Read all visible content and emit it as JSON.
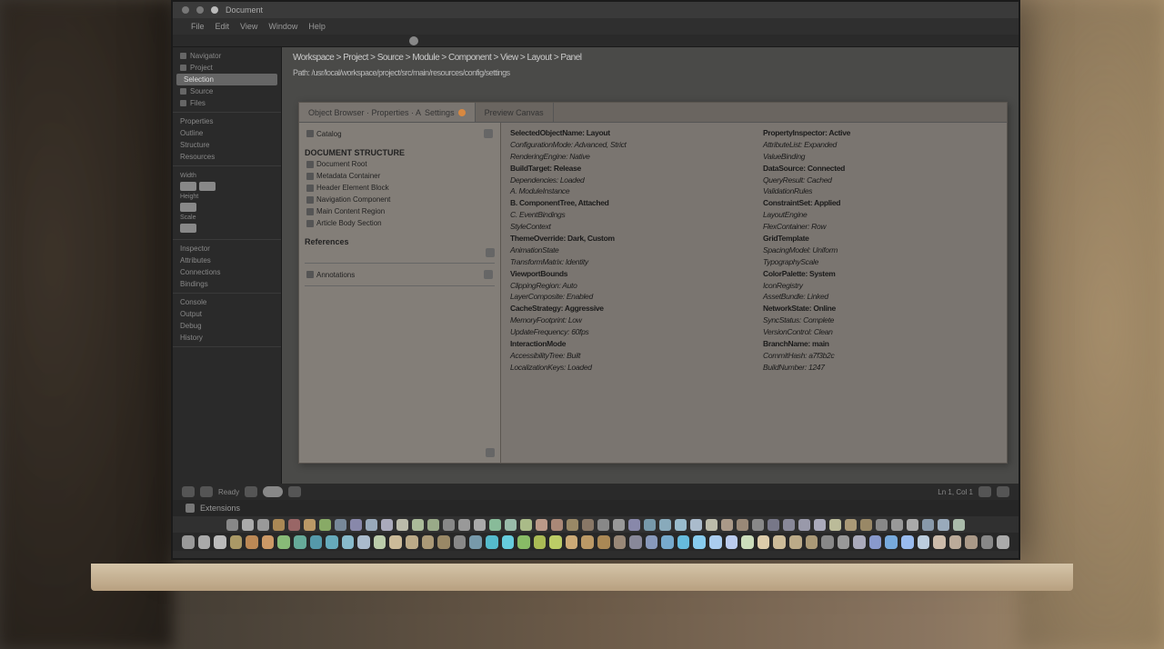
{
  "titlebar": {
    "label": "Document"
  },
  "menubar": {
    "items": [
      "File",
      "Edit",
      "View",
      "Window",
      "Help"
    ]
  },
  "sidebar": {
    "section1": [
      "Navigator",
      "Project",
      "Source",
      "Files"
    ],
    "highlighted": "Selection",
    "section2": [
      "Properties",
      "Outline",
      "Structure",
      "Resources"
    ],
    "controls": {
      "label1": "Width",
      "label2": "Height",
      "label3": "Scale"
    },
    "section3": [
      "Inspector",
      "Attributes",
      "Connections",
      "Bindings"
    ],
    "section4": [
      "Console",
      "Output",
      "Debug",
      "History"
    ]
  },
  "breadcrumb": {
    "line1": "Workspace > Project > Source > Module > Component > View > Layout > Panel",
    "line2": "Path: /usr/local/workspace/project/src/main/resources/config/settings"
  },
  "panel": {
    "tab1": "Object Browser · Properties · A",
    "tab1_suffix": "Settings",
    "tab2": "Preview Canvas",
    "left": {
      "header": "Catalog",
      "section1_title": "DOCUMENT STRUCTURE",
      "section1_items": [
        "Document Root",
        "Metadata Container",
        "Header Element Block",
        "Navigation Component",
        "Main Content Region",
        "Article Body Section"
      ],
      "section2_title": "References",
      "footer_item": "Annotations"
    },
    "col1": [
      "SelectedObjectName: Layout",
      "ConfigurationMode: Advanced, Strict",
      "RenderingEngine: Native",
      "BuildTarget: Release",
      "Dependencies: Loaded",
      "A. ModuleInstance",
      "B. ComponentTree, Attached",
      "C. EventBindings",
      "StyleContext",
      "ThemeOverride: Dark, Custom",
      "AnimationState",
      "TransformMatrix: Identity",
      "ViewportBounds",
      "ClippingRegion: Auto",
      "LayerComposite: Enabled",
      "CacheStrategy: Aggressive",
      "MemoryFootprint: Low",
      "UpdateFrequency: 60fps",
      "InteractionMode",
      "AccessibilityTree: Built",
      "LocalizationKeys: Loaded"
    ],
    "col2": [
      "PropertyInspector: Active",
      "AttributeList: Expanded",
      "ValueBinding",
      "DataSource: Connected",
      "QueryResult: Cached",
      "ValidationRules",
      "ConstraintSet: Applied",
      "LayoutEngine",
      "FlexContainer: Row",
      "GridTemplate",
      "SpacingModel: Uniform",
      "TypographyScale",
      "ColorPalette: System",
      "IconRegistry",
      "AssetBundle: Linked",
      "NetworkState: Online",
      "SyncStatus: Complete",
      "VersionControl: Clean",
      "BranchName: main",
      "CommitHash: a7f3b2c",
      "BuildNumber: 1247"
    ]
  },
  "statusbar": {
    "left": "Ready",
    "right": "Ln 1, Col 1"
  },
  "toolbar_text": "Extensions",
  "dock1_colors": [
    "#888",
    "#aaa",
    "#999",
    "#a85",
    "#966",
    "#b96",
    "#8a6",
    "#789",
    "#88a",
    "#9ab",
    "#aab",
    "#bba",
    "#ab9",
    "#9a8",
    "#888",
    "#999",
    "#aaa",
    "#8b9",
    "#9ba",
    "#ab8",
    "#b98",
    "#a87",
    "#986",
    "#876",
    "#888",
    "#999",
    "#88a",
    "#79a",
    "#8ab",
    "#9bc",
    "#abc",
    "#bba",
    "#a98",
    "#987",
    "#888",
    "#778",
    "#889",
    "#99a",
    "#aab",
    "#bb9",
    "#a97",
    "#986",
    "#888",
    "#999",
    "#aaa",
    "#89a",
    "#9ab",
    "#aba"
  ],
  "dock2_colors": [
    "#999",
    "#aaa",
    "#bbb",
    "#a96",
    "#b85",
    "#c96",
    "#8b7",
    "#6a9",
    "#59a",
    "#6ab",
    "#8bc",
    "#abc",
    "#bca",
    "#cb9",
    "#ba8",
    "#a97",
    "#986",
    "#888",
    "#79a",
    "#5bc",
    "#6cd",
    "#8b6",
    "#ab5",
    "#bc6",
    "#ca7",
    "#b96",
    "#a85",
    "#987",
    "#889",
    "#89b",
    "#7ac",
    "#6bd",
    "#8ce",
    "#ace",
    "#bce",
    "#cdb",
    "#dca",
    "#cb9",
    "#ba8",
    "#a97",
    "#888",
    "#999",
    "#aab",
    "#89c",
    "#7ad",
    "#9be",
    "#bcd",
    "#cba",
    "#ba9",
    "#a98",
    "#888",
    "#aaa"
  ]
}
